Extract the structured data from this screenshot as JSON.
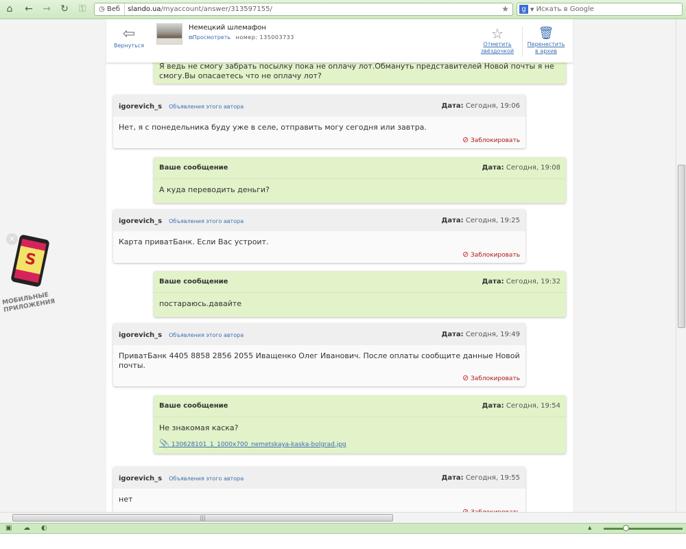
{
  "browser": {
    "web_label": "Веб",
    "url_host": "slando.ua",
    "url_path": "/myaccount/answer/313597155/",
    "search_placeholder": "Искать в Google"
  },
  "header": {
    "back_label": "Вернуться",
    "ad_title": "Немецкий шлемафон",
    "view_label": "Просмотреть",
    "number_label": "номер: 135003733",
    "star_label_1": "Отметить",
    "star_label_2": "звёздочкой",
    "archive_label_1": "Перенестить",
    "archive_label_2": "в архив"
  },
  "promo": {
    "line1": "МОБИЛЬНЫЕ",
    "line2": "ПРИЛОЖЕНИЯ"
  },
  "labels": {
    "date": "Дата:",
    "author_ads": "Объявления этого автора",
    "block": "Заблокировать",
    "mine": "Ваше сообщение"
  },
  "messages": [
    {
      "type": "mine",
      "text": "Я ведь не смогу забрать посылку пока не оплачу лот.Обмануть представителей Новой почты я не смогу.Вы опасаетесь что не оплачу лот?"
    },
    {
      "type": "theirs",
      "author": "igorevich_s",
      "date": "Сегодня, 19:06",
      "text": "Нет, я с понедельника буду уже в селе, отправить могу сегодня или завтра."
    },
    {
      "type": "mine",
      "date": "Сегодня, 19:08",
      "text": "А куда переводить деньги?"
    },
    {
      "type": "theirs",
      "author": "igorevich_s",
      "date": "Сегодня, 19:25",
      "text": "Карта приватБанк. Если Вас устроит."
    },
    {
      "type": "mine",
      "date": "Сегодня, 19:32",
      "text": "постараюсь.давайте"
    },
    {
      "type": "theirs",
      "author": "igorevich_s",
      "date": "Сегодня, 19:49",
      "text": "ПриватБанк 4405 8858 2856 2055 Иващенко Олег Иванович. После оплаты сообщите данные Новой почты."
    },
    {
      "type": "mine",
      "date": "Сегодня, 19:54",
      "text": "Не знакомая каска?",
      "attachment": "130628101_1_1000x700_nemetskaya-kaska-bolgrad.jpg"
    },
    {
      "type": "theirs",
      "author": "igorevich_s",
      "date": "Сегодня, 19:55",
      "text": "нет"
    }
  ]
}
